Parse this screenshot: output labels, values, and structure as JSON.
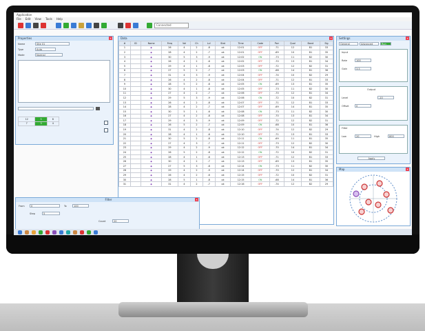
{
  "app": {
    "title": "Application",
    "menu": [
      "File",
      "Edit",
      "View",
      "Tools",
      "Help"
    ]
  },
  "toolbar": {
    "status_text": "Connected"
  },
  "left_panel": {
    "title": "Properties",
    "fields": [
      {
        "label": "Name",
        "value": "Site 01"
      },
      {
        "label": "Type",
        "value": "Auto"
      },
      {
        "label": "Mode",
        "value": "Normal"
      }
    ],
    "mini_table": [
      [
        "12",
        "5",
        "8"
      ],
      [
        "7",
        "3",
        "4"
      ]
    ]
  },
  "grid": {
    "title": "Data",
    "columns": [
      "#",
      "ID",
      "Name",
      "Freq",
      "Val",
      "Ch",
      "Lvl",
      "Stat",
      "Time",
      "Code",
      "Pwr",
      "Qual",
      "Band",
      "Sig"
    ],
    "rows": [
      [
        "1",
        "",
        "◆",
        "26",
        "4",
        "2",
        "-8",
        "ok",
        "12:01",
        "OFF",
        "-71",
        "12",
        "B1",
        "33"
      ],
      [
        "2",
        "",
        "◆",
        "28",
        "4",
        "2",
        "-7",
        "ok",
        "12:01",
        "OFF",
        "-69",
        "10",
        "B1",
        "35"
      ],
      [
        "3",
        "",
        "◆",
        "30",
        "5",
        "3",
        "-9",
        "ok",
        "12:02",
        "ON",
        "-73",
        "11",
        "B2",
        "30"
      ],
      [
        "4",
        "",
        "◆",
        "26",
        "4",
        "2",
        "-6",
        "ok",
        "12:02",
        "OFF",
        "-70",
        "13",
        "B1",
        "34"
      ],
      [
        "5",
        "",
        "◆",
        "29",
        "4",
        "1",
        "-8",
        "ok",
        "12:03",
        "OFF",
        "-72",
        "12",
        "B2",
        "31"
      ],
      [
        "6",
        "",
        "◆",
        "27",
        "5",
        "2",
        "-7",
        "ok",
        "12:03",
        "ON",
        "-68",
        "14",
        "B1",
        "36"
      ],
      [
        "7",
        "",
        "◆",
        "31",
        "4",
        "3",
        "-9",
        "ok",
        "12:04",
        "OFF",
        "-74",
        "10",
        "B2",
        "29"
      ],
      [
        "8",
        "",
        "◆",
        "26",
        "4",
        "2",
        "-8",
        "ok",
        "12:04",
        "OFF",
        "-71",
        "12",
        "B1",
        "33"
      ],
      [
        "9",
        "",
        "◆",
        "28",
        "5",
        "2",
        "-6",
        "ok",
        "12:05",
        "ON",
        "-69",
        "13",
        "B1",
        "35"
      ],
      [
        "10",
        "",
        "◆",
        "30",
        "4",
        "1",
        "-8",
        "ok",
        "12:05",
        "OFF",
        "-73",
        "11",
        "B2",
        "30"
      ],
      [
        "11",
        "",
        "◆",
        "27",
        "4",
        "2",
        "-7",
        "ok",
        "12:06",
        "OFF",
        "-70",
        "12",
        "B1",
        "34"
      ],
      [
        "12",
        "",
        "◆",
        "29",
        "5",
        "3",
        "-9",
        "ok",
        "12:06",
        "ON",
        "-72",
        "10",
        "B2",
        "31"
      ],
      [
        "13",
        "",
        "◆",
        "26",
        "4",
        "2",
        "-8",
        "ok",
        "12:07",
        "OFF",
        "-71",
        "12",
        "B1",
        "33"
      ],
      [
        "14",
        "",
        "◆",
        "28",
        "4",
        "2",
        "-7",
        "ok",
        "12:07",
        "OFF",
        "-69",
        "14",
        "B1",
        "35"
      ],
      [
        "15",
        "",
        "◆",
        "30",
        "5",
        "1",
        "-6",
        "ok",
        "12:08",
        "ON",
        "-73",
        "11",
        "B2",
        "30"
      ],
      [
        "16",
        "",
        "◆",
        "27",
        "4",
        "2",
        "-8",
        "ok",
        "12:08",
        "OFF",
        "-70",
        "13",
        "B1",
        "34"
      ],
      [
        "17",
        "",
        "◆",
        "29",
        "4",
        "3",
        "-9",
        "ok",
        "12:09",
        "OFF",
        "-72",
        "12",
        "B2",
        "31"
      ],
      [
        "18",
        "",
        "◆",
        "26",
        "5",
        "2",
        "-7",
        "ok",
        "12:09",
        "ON",
        "-68",
        "10",
        "B1",
        "36"
      ],
      [
        "19",
        "",
        "◆",
        "31",
        "4",
        "2",
        "-8",
        "ok",
        "12:10",
        "OFF",
        "-74",
        "12",
        "B2",
        "29"
      ],
      [
        "20",
        "",
        "◆",
        "28",
        "4",
        "1",
        "-6",
        "ok",
        "12:10",
        "OFF",
        "-71",
        "13",
        "B1",
        "33"
      ],
      [
        "21",
        "",
        "◆",
        "30",
        "5",
        "2",
        "-8",
        "ok",
        "12:11",
        "ON",
        "-69",
        "11",
        "B1",
        "35"
      ],
      [
        "22",
        "",
        "◆",
        "27",
        "4",
        "3",
        "-7",
        "ok",
        "12:11",
        "OFF",
        "-73",
        "12",
        "B2",
        "30"
      ],
      [
        "23",
        "",
        "◆",
        "29",
        "4",
        "2",
        "-9",
        "ok",
        "12:12",
        "OFF",
        "-70",
        "14",
        "B1",
        "34"
      ],
      [
        "24",
        "",
        "◆",
        "26",
        "5",
        "2",
        "-8",
        "ok",
        "12:12",
        "ON",
        "-72",
        "10",
        "B2",
        "31"
      ],
      [
        "25",
        "",
        "◆",
        "28",
        "4",
        "1",
        "-6",
        "ok",
        "12:13",
        "OFF",
        "-71",
        "12",
        "B1",
        "33"
      ],
      [
        "26",
        "",
        "◆",
        "30",
        "4",
        "2",
        "-7",
        "ok",
        "12:13",
        "OFF",
        "-69",
        "13",
        "B1",
        "35"
      ],
      [
        "27",
        "",
        "◆",
        "27",
        "5",
        "3",
        "-8",
        "ok",
        "12:14",
        "ON",
        "-73",
        "11",
        "B2",
        "30"
      ],
      [
        "28",
        "",
        "◆",
        "29",
        "4",
        "2",
        "-9",
        "ok",
        "12:14",
        "OFF",
        "-70",
        "12",
        "B1",
        "34"
      ],
      [
        "29",
        "",
        "◆",
        "26",
        "4",
        "2",
        "-6",
        "ok",
        "12:15",
        "OFF",
        "-72",
        "10",
        "B2",
        "31"
      ],
      [
        "30",
        "",
        "◆",
        "28",
        "5",
        "1",
        "-8",
        "ok",
        "12:15",
        "ON",
        "-68",
        "14",
        "B1",
        "36"
      ],
      [
        "31",
        "",
        "◆",
        "31",
        "4",
        "2",
        "-7",
        "ok",
        "12:16",
        "OFF",
        "-74",
        "12",
        "B2",
        "29"
      ]
    ]
  },
  "right_panel": {
    "title": "Settings",
    "tabs": [
      "General",
      "Advanced",
      "Run"
    ],
    "groups": [
      {
        "title": "Input",
        "fields": [
          {
            "label": "Rate",
            "value": "100"
          },
          {
            "label": "Gain",
            "value": "3.5"
          }
        ]
      },
      {
        "title": "Output",
        "fields": [
          {
            "label": "Level",
            "value": "-10"
          },
          {
            "label": "Offset",
            "value": "0"
          }
        ]
      },
      {
        "title": "Filter",
        "fields": [
          {
            "label": "Low",
            "value": "20"
          },
          {
            "label": "High",
            "value": "800"
          }
        ]
      }
    ],
    "apply_label": "Apply"
  },
  "map_panel": {
    "title": "Map"
  },
  "bottom_dialog": {
    "title": "Filter",
    "fields": [
      {
        "label": "From",
        "value": "0"
      },
      {
        "label": "To",
        "value": "100"
      },
      {
        "label": "Step",
        "value": "5"
      },
      {
        "label": "Count",
        "value": "20"
      }
    ]
  },
  "colors": {
    "accent": "#3a7bd5",
    "panel": "#eaf2fb",
    "close": "#e34"
  }
}
